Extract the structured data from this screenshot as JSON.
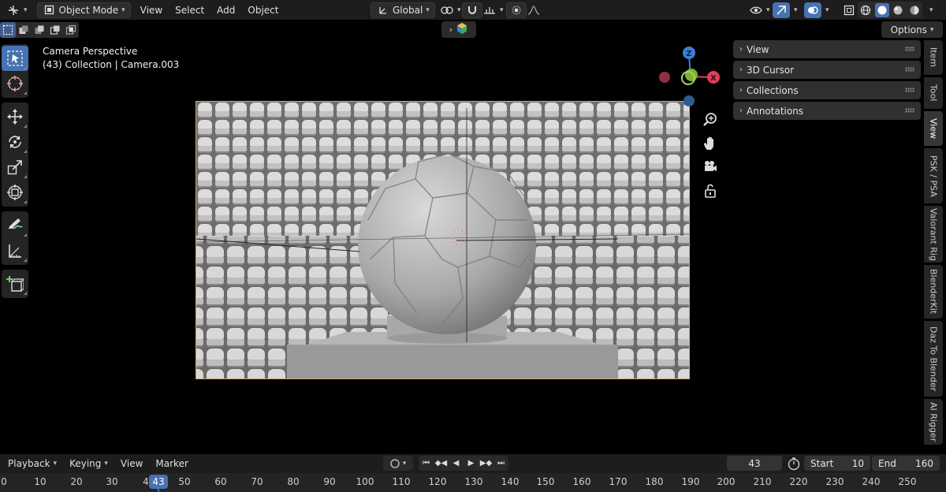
{
  "header": {
    "mode": "Object Mode",
    "menus": [
      "View",
      "Select",
      "Add",
      "Object"
    ],
    "orientation": "Global"
  },
  "options_label": "Options",
  "viewport": {
    "title": "Camera Perspective",
    "subtitle": "(43) Collection | Camera.003"
  },
  "gizmo": {
    "z": "Z",
    "x": "X"
  },
  "npanel": {
    "panels": [
      "View",
      "3D Cursor",
      "Collections",
      "Annotations"
    ]
  },
  "tabs": [
    "Item",
    "Tool",
    "View",
    "PSK / PSA",
    "Valorant Rig",
    "BlenderKit",
    "Daz To Blender",
    "AI Rigger"
  ],
  "timeline": {
    "menus": [
      "Playback",
      "Keying",
      "View",
      "Marker"
    ],
    "current_frame": "43",
    "start_label": "Start",
    "start_value": "10",
    "end_label": "End",
    "end_value": "160",
    "ticks": [
      "0",
      "10",
      "20",
      "30",
      "4",
      "50",
      "60",
      "70",
      "80",
      "90",
      "100",
      "110",
      "120",
      "130",
      "140",
      "150",
      "160",
      "170",
      "180",
      "190",
      "200",
      "210",
      "220",
      "230",
      "240",
      "250"
    ]
  },
  "colors": {
    "accent": "#4772b3",
    "axis_x": "#e0405a",
    "axis_y": "#7fb031",
    "axis_z": "#3f7fd8",
    "camera_border": "#d8a66a"
  }
}
